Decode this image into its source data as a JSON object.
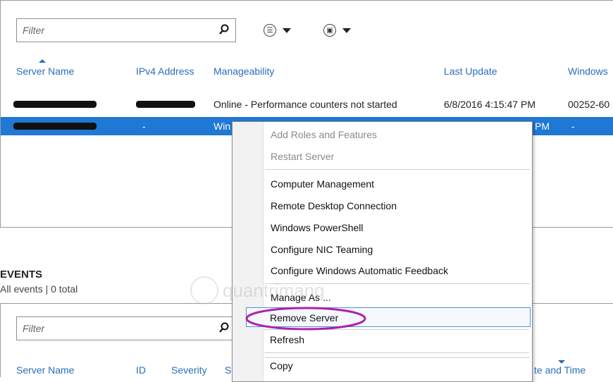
{
  "filter": {
    "placeholder": "Filter"
  },
  "toolbar": {
    "list_icon": "list-view-icon",
    "save_icon": "save-icon"
  },
  "servers": {
    "headers": [
      "Server Name",
      "IPv4 Address",
      "Manageability",
      "Last Update",
      "Windows"
    ],
    "rows": [
      {
        "ipv4": "",
        "manageability": "Online - Performance counters not started",
        "last_update": "6/8/2016 4:15:47 PM",
        "windows": "00252-60"
      },
      {
        "ipv4": "-",
        "manageability": "Win",
        "last_update": "PM",
        "windows": "-"
      }
    ]
  },
  "events": {
    "title": "EVENTS",
    "subtitle": "All events | 0 total",
    "filter_placeholder": "Filter",
    "headers": [
      "Server Name",
      "ID",
      "Severity",
      "S",
      "te and Time"
    ]
  },
  "context_menu": {
    "items": [
      {
        "label": "Add Roles and Features",
        "disabled": true
      },
      {
        "label": "Restart Server",
        "disabled": true
      },
      {
        "label": "Computer Management",
        "disabled": false
      },
      {
        "label": "Remote Desktop Connection",
        "disabled": false
      },
      {
        "label": "Windows PowerShell",
        "disabled": false
      },
      {
        "label": "Configure NIC Teaming",
        "disabled": false
      },
      {
        "label": "Configure Windows Automatic Feedback",
        "disabled": false
      },
      {
        "label": "Manage As ...",
        "disabled": false
      },
      {
        "label": "Remove Server",
        "disabled": false
      },
      {
        "label": "Refresh",
        "disabled": false
      },
      {
        "label": "Copy",
        "disabled": false
      }
    ]
  },
  "watermark": "quantrimang",
  "colors": {
    "accent": "#2a6ebb",
    "selection": "#1e78d4",
    "annotation": "#b020b0"
  }
}
